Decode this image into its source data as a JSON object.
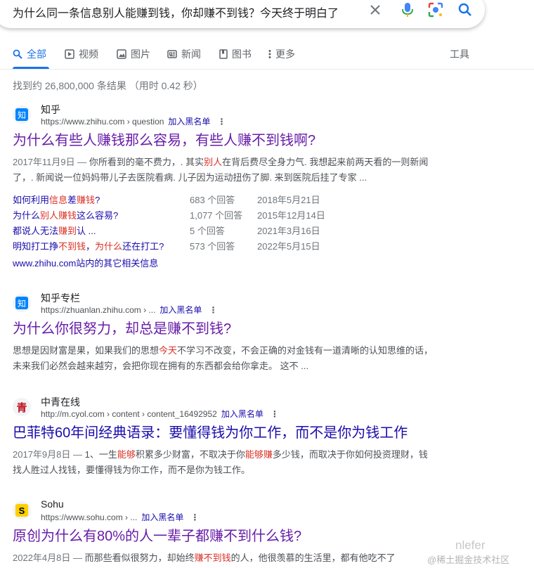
{
  "search": {
    "query": "为什么同一条信息别人能赚到钱，你却赚不到钱？今天终于明白了",
    "icons": [
      "close-icon",
      "mic-icon",
      "lens-icon",
      "search-icon"
    ]
  },
  "tabs": [
    {
      "label": "全部",
      "icon": "search-icon",
      "active": true
    },
    {
      "label": "视频",
      "icon": "play-icon"
    },
    {
      "label": "图片",
      "icon": "image-icon"
    },
    {
      "label": "新闻",
      "icon": "news-icon"
    },
    {
      "label": "图书",
      "icon": "book-icon"
    },
    {
      "label": "更多",
      "icon": "more-icon"
    }
  ],
  "tools_label": "工具",
  "stats": "找到约 26,800,000 条结果 （用时 0.42 秒）",
  "results": [
    {
      "site_name": "知乎",
      "favicon": "知",
      "url": "https://www.zhihu.com › question",
      "blacklist": "加入黑名单",
      "title": "为什么有些人赚钱那么容易，有些人赚不到钱啊?",
      "date": "2017年11月9日 — ",
      "snippet_a": "你所看到的毫不费力，. 其实",
      "snippet_hl": "别人",
      "snippet_b": "在背后费尽全身力气. 我想起来前两天看的一则新闻了，. 新闻说一位妈妈带儿子去医院看病. 儿子因为运动扭伤了脚. 来到医院后挂了专家 ...",
      "subresults": [
        {
          "q1": "如何利用",
          "q2": "信息",
          "q3": "差",
          "q4": "赚钱",
          "q5": "?",
          "count": "683 个回答",
          "date": "2018年5月21日"
        },
        {
          "q1": "为什么",
          "q2": "别人赚钱",
          "q3": "这么容易?",
          "q4": "",
          "q5": "",
          "count": "1,077 个回答",
          "date": "2015年12月14日"
        },
        {
          "q1": "都说人无法",
          "q2": "赚到",
          "q3": "认 ...",
          "q4": "",
          "q5": "",
          "count": "5 个回答",
          "date": "2021年3月16日"
        },
        {
          "q1": "明知打工挣",
          "q2": "不到钱",
          "q3": "，",
          "q4": "为什么",
          "q5": "还在打工?",
          "count": "573 个回答",
          "date": "2022年5月15日"
        }
      ],
      "more": "www.zhihu.com站内的其它相关信息"
    },
    {
      "site_name": "知乎专栏",
      "favicon": "知",
      "url": "https://zhuanlan.zhihu.com › ...",
      "blacklist": "加入黑名单",
      "title": "为什么你很努力，却总是赚不到钱?",
      "snippet_a": "思想是因财富是果，如果我们的思想",
      "snippet_hl": "今天",
      "snippet_b": "不学习不改变，不会正确的对金钱有一道清晰的认知思维的话，未来我们必然会越来越穷，会把你现在拥有的东西都会给你拿走。 这不 ..."
    },
    {
      "site_name": "中青在线",
      "favicon": "青",
      "url": "http://m.cyol.com › content › content_16492952",
      "blacklist": "加入黑名单",
      "title": "巴菲特60年间经典语录：要懂得钱为你工作，而不是你为钱工作",
      "date": "2017年9月8日 — ",
      "snippet_a": "1、一生",
      "snippet_hl": "能够",
      "snippet_b": "积累多少财富，不取决于你",
      "snippet_hl2": "能够赚",
      "snippet_c": "多少钱，而取决于你如何投资理财，钱找人胜过人找钱，要懂得钱为你工作，而不是你为钱工作。"
    },
    {
      "site_name": "Sohu",
      "favicon": "S",
      "url": "https://www.sohu.com › ...",
      "blacklist": "加入黑名单",
      "title": "原创为什么有80%的人一辈子都赚不到什么钱?",
      "date": "2022年4月8日 — ",
      "snippet_a": "而那些看似很努力，却始终",
      "snippet_hl": "赚不到钱",
      "snippet_b": "的人，他很羡慕的生活里，都有他吃不了"
    }
  ],
  "watermark": {
    "big": "nlefer",
    "small": "@稀土掘金技术社区"
  },
  "colors": {
    "link": "#1a0dab",
    "visited": "#681da8",
    "accent": "#1a73e8",
    "highlight": "#d93025"
  }
}
